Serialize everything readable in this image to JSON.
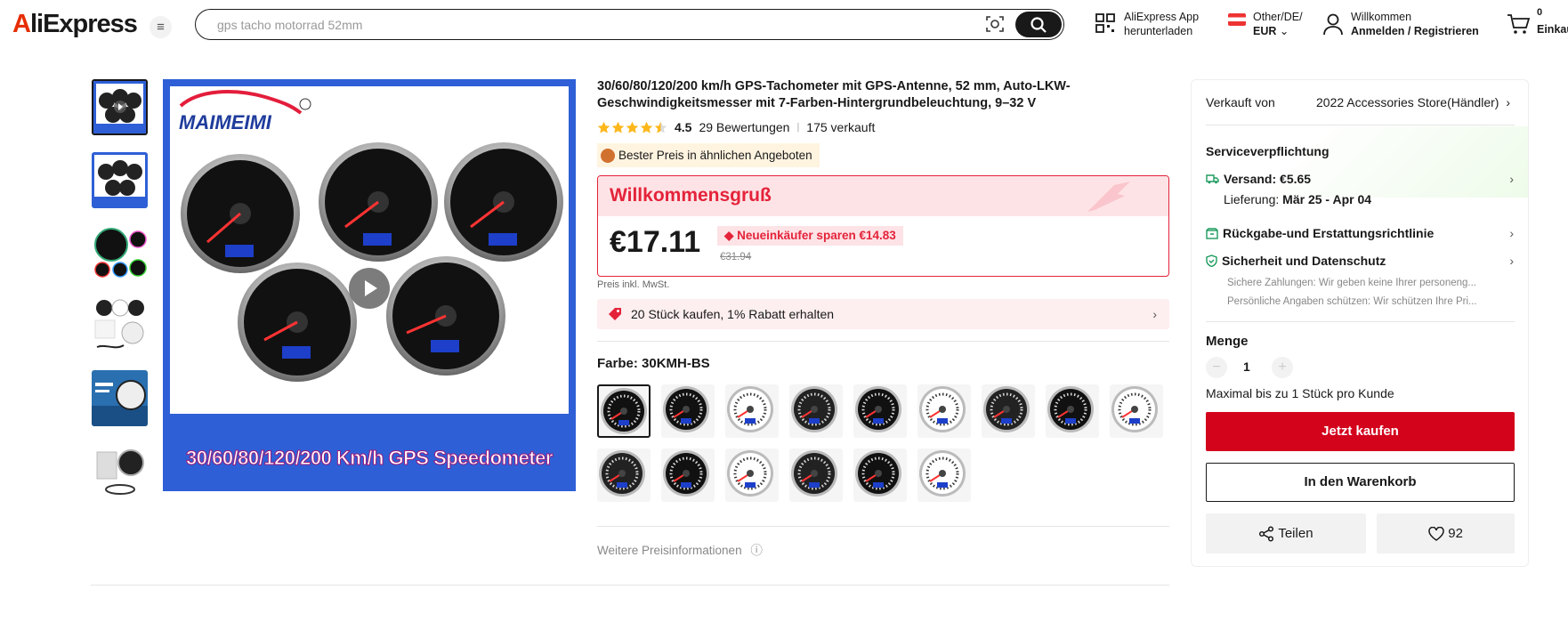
{
  "header": {
    "logo_text": "AliExpress",
    "search_placeholder": "gps tacho motorrad 52mm",
    "app_line1": "AliExpress App",
    "app_line2": "herunterladen",
    "region_line1": "Other/DE/",
    "region_line2": "EUR",
    "account_line1": "Willkommen",
    "account_line2": "Anmelden / Registrieren",
    "cart_count": "0",
    "cart_label": "Einkau"
  },
  "gallery": {
    "thumbs": [
      "video",
      "image-1",
      "image-2",
      "image-3",
      "image-4",
      "image-5"
    ],
    "brand_label": "MAIMEIMI",
    "banner_text": "30/60/80/120/200 Km/h GPS Speedometer"
  },
  "product": {
    "title": "30/60/80/120/200 km/h GPS-Tachometer mit GPS-Antenne, 52 mm, Auto-LKW-Geschwindigkeitsmesser mit 7-Farben-Hintergrundbeleuchtung, 9–32 V",
    "rating": "4.5",
    "reviews": "29 Bewertungen",
    "sold": "175 verkauft",
    "best_price_badge": "Bester Preis in ähnlichen Angeboten",
    "welcome_title": "Willkommensgruß",
    "price": "€17.11",
    "saving_label": "Neueinkäufer sparen €14.83",
    "old_price": "€31.94",
    "tax_note": "Preis inkl. MwSt.",
    "bulk_discount": "20 Stück kaufen, 1% Rabatt erhalten",
    "color_label": "Farbe: 30KMH-BS",
    "more_info": "Weitere Preisinformationen"
  },
  "sidebar": {
    "sold_by_label": "Verkauft von",
    "store_name": "2022 Accessories Store(Händler)",
    "service_title": "Serviceverpflichtung",
    "shipping_label": "Versand: €5.65",
    "delivery_label": "Lieferung:",
    "delivery_dates": "Mär 25 - Apr 04",
    "return_label": "Rückgabe-und Erstattungsrichtlinie",
    "security_label": "Sicherheit und Datenschutz",
    "security_line1": "Sichere Zahlungen: Wir geben keine Ihrer personeng...",
    "security_line2": "Persönliche Angaben schützen: Wir schützen Ihre Pri...",
    "quantity_label": "Menge",
    "quantity_value": "1",
    "max_note": "Maximal bis zu 1 Stück pro Kunde",
    "buy_now": "Jetzt kaufen",
    "add_to_cart": "In den Warenkorb",
    "share": "Teilen",
    "wishlist_count": "92"
  },
  "colors": {
    "accent_red": "#d3031c",
    "brand_orange": "#e62e04",
    "star_color": "#fdb71a"
  }
}
